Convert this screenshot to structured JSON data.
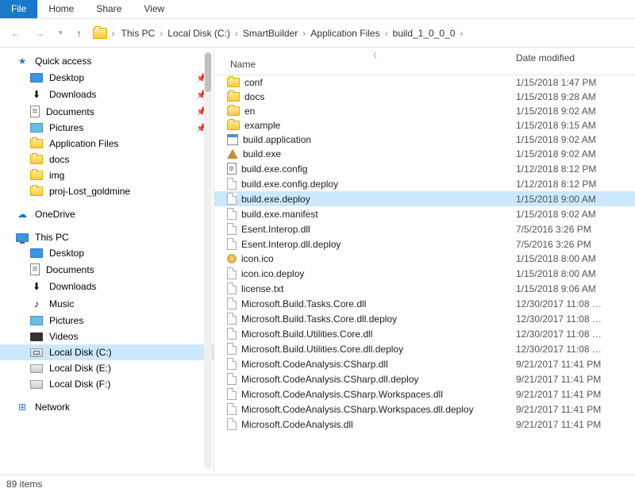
{
  "ribbon": {
    "file": "File",
    "home": "Home",
    "share": "Share",
    "view": "View"
  },
  "breadcrumb": [
    "This PC",
    "Local Disk (C:)",
    "SmartBuilder",
    "Application Files",
    "build_1_0_0_0"
  ],
  "sidebar": {
    "quick": {
      "label": "Quick access",
      "items": [
        {
          "label": "Desktop",
          "icon": "desktop",
          "pin": true
        },
        {
          "label": "Downloads",
          "icon": "down",
          "pin": true
        },
        {
          "label": "Documents",
          "icon": "doc",
          "pin": true
        },
        {
          "label": "Pictures",
          "icon": "pic",
          "pin": true
        },
        {
          "label": "Application Files",
          "icon": "folder"
        },
        {
          "label": "docs",
          "icon": "folder"
        },
        {
          "label": "img",
          "icon": "folder"
        },
        {
          "label": "proj-Lost_goldmine",
          "icon": "folder"
        }
      ]
    },
    "onedrive": {
      "label": "OneDrive"
    },
    "thispc": {
      "label": "This PC",
      "items": [
        {
          "label": "Desktop",
          "icon": "desktop"
        },
        {
          "label": "Documents",
          "icon": "doc"
        },
        {
          "label": "Downloads",
          "icon": "down"
        },
        {
          "label": "Music",
          "icon": "music"
        },
        {
          "label": "Pictures",
          "icon": "pic"
        },
        {
          "label": "Videos",
          "icon": "video"
        },
        {
          "label": "Local Disk (C:)",
          "icon": "diskc",
          "selected": true
        },
        {
          "label": "Local Disk (E:)",
          "icon": "disk"
        },
        {
          "label": "Local Disk (F:)",
          "icon": "disk"
        }
      ]
    },
    "network": {
      "label": "Network"
    }
  },
  "columns": {
    "name": "Name",
    "date": "Date modified"
  },
  "files": [
    {
      "name": "conf",
      "date": "1/15/2018 1:47 PM",
      "icon": "folder"
    },
    {
      "name": "docs",
      "date": "1/15/2018 9:28 AM",
      "icon": "folder"
    },
    {
      "name": "en",
      "date": "1/15/2018 9:02 AM",
      "icon": "folder"
    },
    {
      "name": "example",
      "date": "1/15/2018 9:15 AM",
      "icon": "folder"
    },
    {
      "name": "build.application",
      "date": "1/15/2018 9:02 AM",
      "icon": "app"
    },
    {
      "name": "build.exe",
      "date": "1/15/2018 9:02 AM",
      "icon": "exe"
    },
    {
      "name": "build.exe.config",
      "date": "1/12/2018 8:12 PM",
      "icon": "cfg"
    },
    {
      "name": "build.exe.config.deploy",
      "date": "1/12/2018 8:12 PM",
      "icon": "file"
    },
    {
      "name": "build.exe.deploy",
      "date": "1/15/2018 9:00 AM",
      "icon": "file",
      "selected": true
    },
    {
      "name": "build.exe.manifest",
      "date": "1/15/2018 9:02 AM",
      "icon": "file"
    },
    {
      "name": "Esent.Interop.dll",
      "date": "7/5/2016 3:26 PM",
      "icon": "file"
    },
    {
      "name": "Esent.Interop.dll.deploy",
      "date": "7/5/2016 3:26 PM",
      "icon": "file"
    },
    {
      "name": "icon.ico",
      "date": "1/15/2018 8:00 AM",
      "icon": "ico"
    },
    {
      "name": "icon.ico.deploy",
      "date": "1/15/2018 8:00 AM",
      "icon": "file"
    },
    {
      "name": "license.txt",
      "date": "1/15/2018 9:06 AM",
      "icon": "file"
    },
    {
      "name": "Microsoft.Build.Tasks.Core.dll",
      "date": "12/30/2017 11:08 …",
      "icon": "file"
    },
    {
      "name": "Microsoft.Build.Tasks.Core.dll.deploy",
      "date": "12/30/2017 11:08 …",
      "icon": "file"
    },
    {
      "name": "Microsoft.Build.Utilities.Core.dll",
      "date": "12/30/2017 11:08 …",
      "icon": "file"
    },
    {
      "name": "Microsoft.Build.Utilities.Core.dll.deploy",
      "date": "12/30/2017 11:08 …",
      "icon": "file"
    },
    {
      "name": "Microsoft.CodeAnalysis.CSharp.dll",
      "date": "9/21/2017 11:41 PM",
      "icon": "file"
    },
    {
      "name": "Microsoft.CodeAnalysis.CSharp.dll.deploy",
      "date": "9/21/2017 11:41 PM",
      "icon": "file"
    },
    {
      "name": "Microsoft.CodeAnalysis.CSharp.Workspaces.dll",
      "date": "9/21/2017 11:41 PM",
      "icon": "file"
    },
    {
      "name": "Microsoft.CodeAnalysis.CSharp.Workspaces.dll.deploy",
      "date": "9/21/2017 11:41 PM",
      "icon": "file"
    },
    {
      "name": "Microsoft.CodeAnalysis.dll",
      "date": "9/21/2017 11:41 PM",
      "icon": "file"
    }
  ],
  "status": "89 items"
}
